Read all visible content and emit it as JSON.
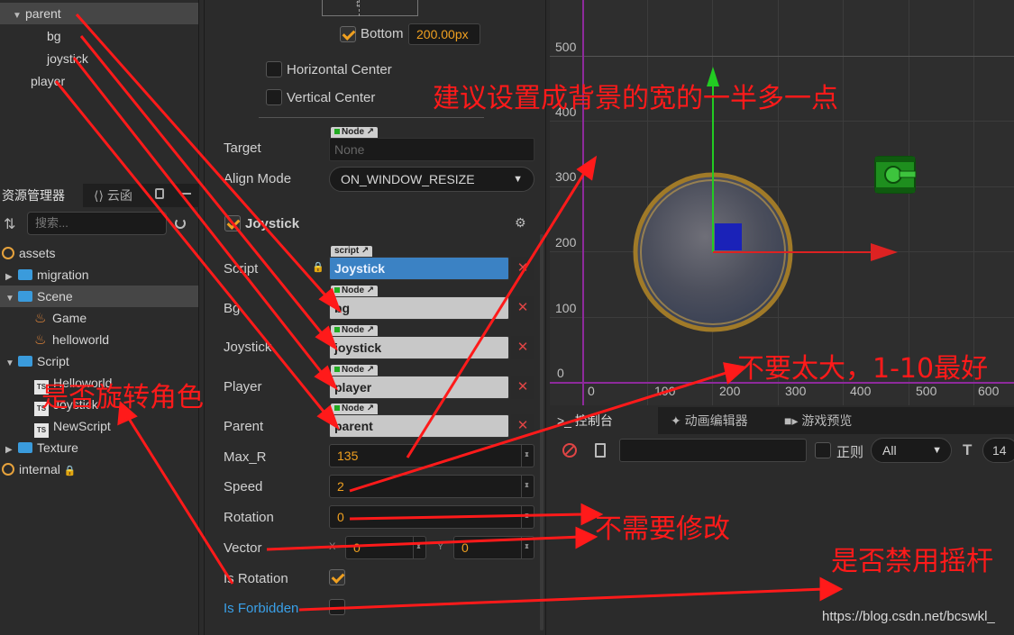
{
  "hierarchy": {
    "items": [
      {
        "label": "parent",
        "expanded": true
      },
      {
        "label": "bg"
      },
      {
        "label": "joystick"
      },
      {
        "label": "player"
      }
    ]
  },
  "assets_panel": {
    "tab_assets": "资源管理器",
    "tab_cloud": "云函",
    "search_placeholder": "搜索...",
    "items": [
      {
        "label": "assets"
      },
      {
        "label": "migration"
      },
      {
        "label": "Scene"
      },
      {
        "label": "Game"
      },
      {
        "label": "helloworld"
      },
      {
        "label": "Script"
      },
      {
        "label": "Helloworld"
      },
      {
        "label": "Joystick"
      },
      {
        "label": "NewScript"
      },
      {
        "label": "Texture"
      },
      {
        "label": "internal"
      }
    ]
  },
  "inspector": {
    "bottom_label": "Bottom",
    "bottom_value": "200.00px",
    "horizontal_center": "Horizontal Center",
    "vertical_center": "Vertical Center",
    "target_label": "Target",
    "target_tag": "Node",
    "target_value": "None",
    "align_mode_label": "Align Mode",
    "align_mode_value": "ON_WINDOW_RESIZE",
    "component_title": "Joystick",
    "script_label": "Script",
    "script_tag": "script",
    "script_value": "Joystick",
    "bg_label": "Bg",
    "bg_tag": "Node",
    "bg_value": "bg",
    "joystick_label": "Joystick",
    "joystick_tag": "Node",
    "joystick_value": "joystick",
    "player_label": "Player",
    "player_tag": "Node",
    "player_value": "player",
    "parent_label": "Parent",
    "parent_tag": "Node",
    "parent_value": "parent",
    "max_r_label": "Max_R",
    "max_r_value": "135",
    "speed_label": "Speed",
    "speed_value": "2",
    "rotation_label": "Rotation",
    "rotation_value": "0",
    "vector_label": "Vector",
    "vector_x_label": "X",
    "vector_x": "0",
    "vector_y_label": "Y",
    "vector_y": "0",
    "is_rotation_label": "Is Rotation",
    "is_rotation": true,
    "is_forbidden_label": "Is Forbidden",
    "is_forbidden": false
  },
  "scene": {
    "y_ticks": [
      "500",
      "400",
      "300",
      "200",
      "100",
      "0"
    ],
    "x_ticks": [
      "0",
      "100",
      "200",
      "300",
      "400",
      "500",
      "600"
    ]
  },
  "bottom_panel": {
    "tab_console": "控制台",
    "tab_animation": "动画编辑器",
    "tab_preview": "游戏预览",
    "regex_label": "正则",
    "level_value": "All",
    "font_size_value": "14"
  },
  "annotations": {
    "a1": "建议设置成背景的宽的一半多一点",
    "a2": "不要太大，1-10最好",
    "a3": "是否旋转角色",
    "a4": "不需要修改",
    "a5": "是否禁用摇杆"
  },
  "watermark": "https://blog.csdn.net/bcswkl_",
  "colors": {
    "accent": "#f0a020",
    "annotation": "#ff1a1a",
    "selection": "#3b82c4"
  }
}
